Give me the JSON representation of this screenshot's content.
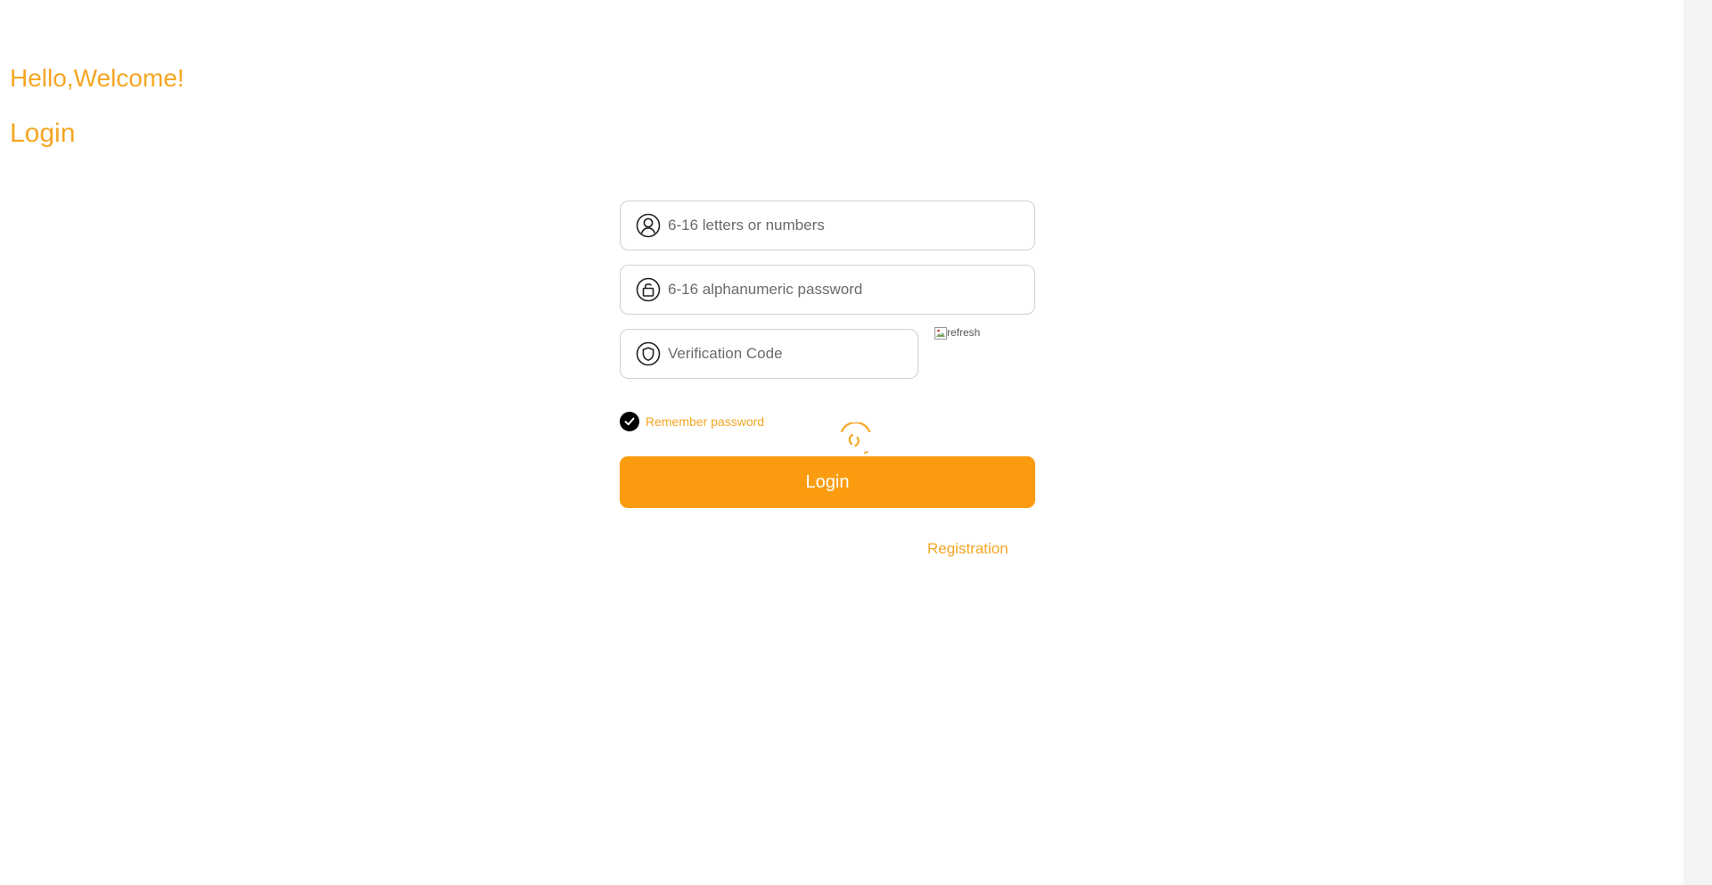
{
  "header": {
    "greeting": "Hello,Welcome!",
    "title": "Login"
  },
  "form": {
    "username": {
      "placeholder": "6-16 letters or numbers",
      "value": "",
      "icon": "user-icon"
    },
    "password": {
      "placeholder": "6-16 alphanumeric password",
      "value": "",
      "icon": "lock-icon"
    },
    "verification": {
      "placeholder": "Verification Code",
      "value": "",
      "icon": "shield-icon"
    },
    "captcha_alt": "refresh",
    "remember_label": "Remember password",
    "remember_checked": true,
    "login_label": "Login",
    "register_label": "Registration"
  },
  "colors": {
    "accent": "#f5a623",
    "button": "#fb9c10",
    "border": "#cfcfcf"
  }
}
